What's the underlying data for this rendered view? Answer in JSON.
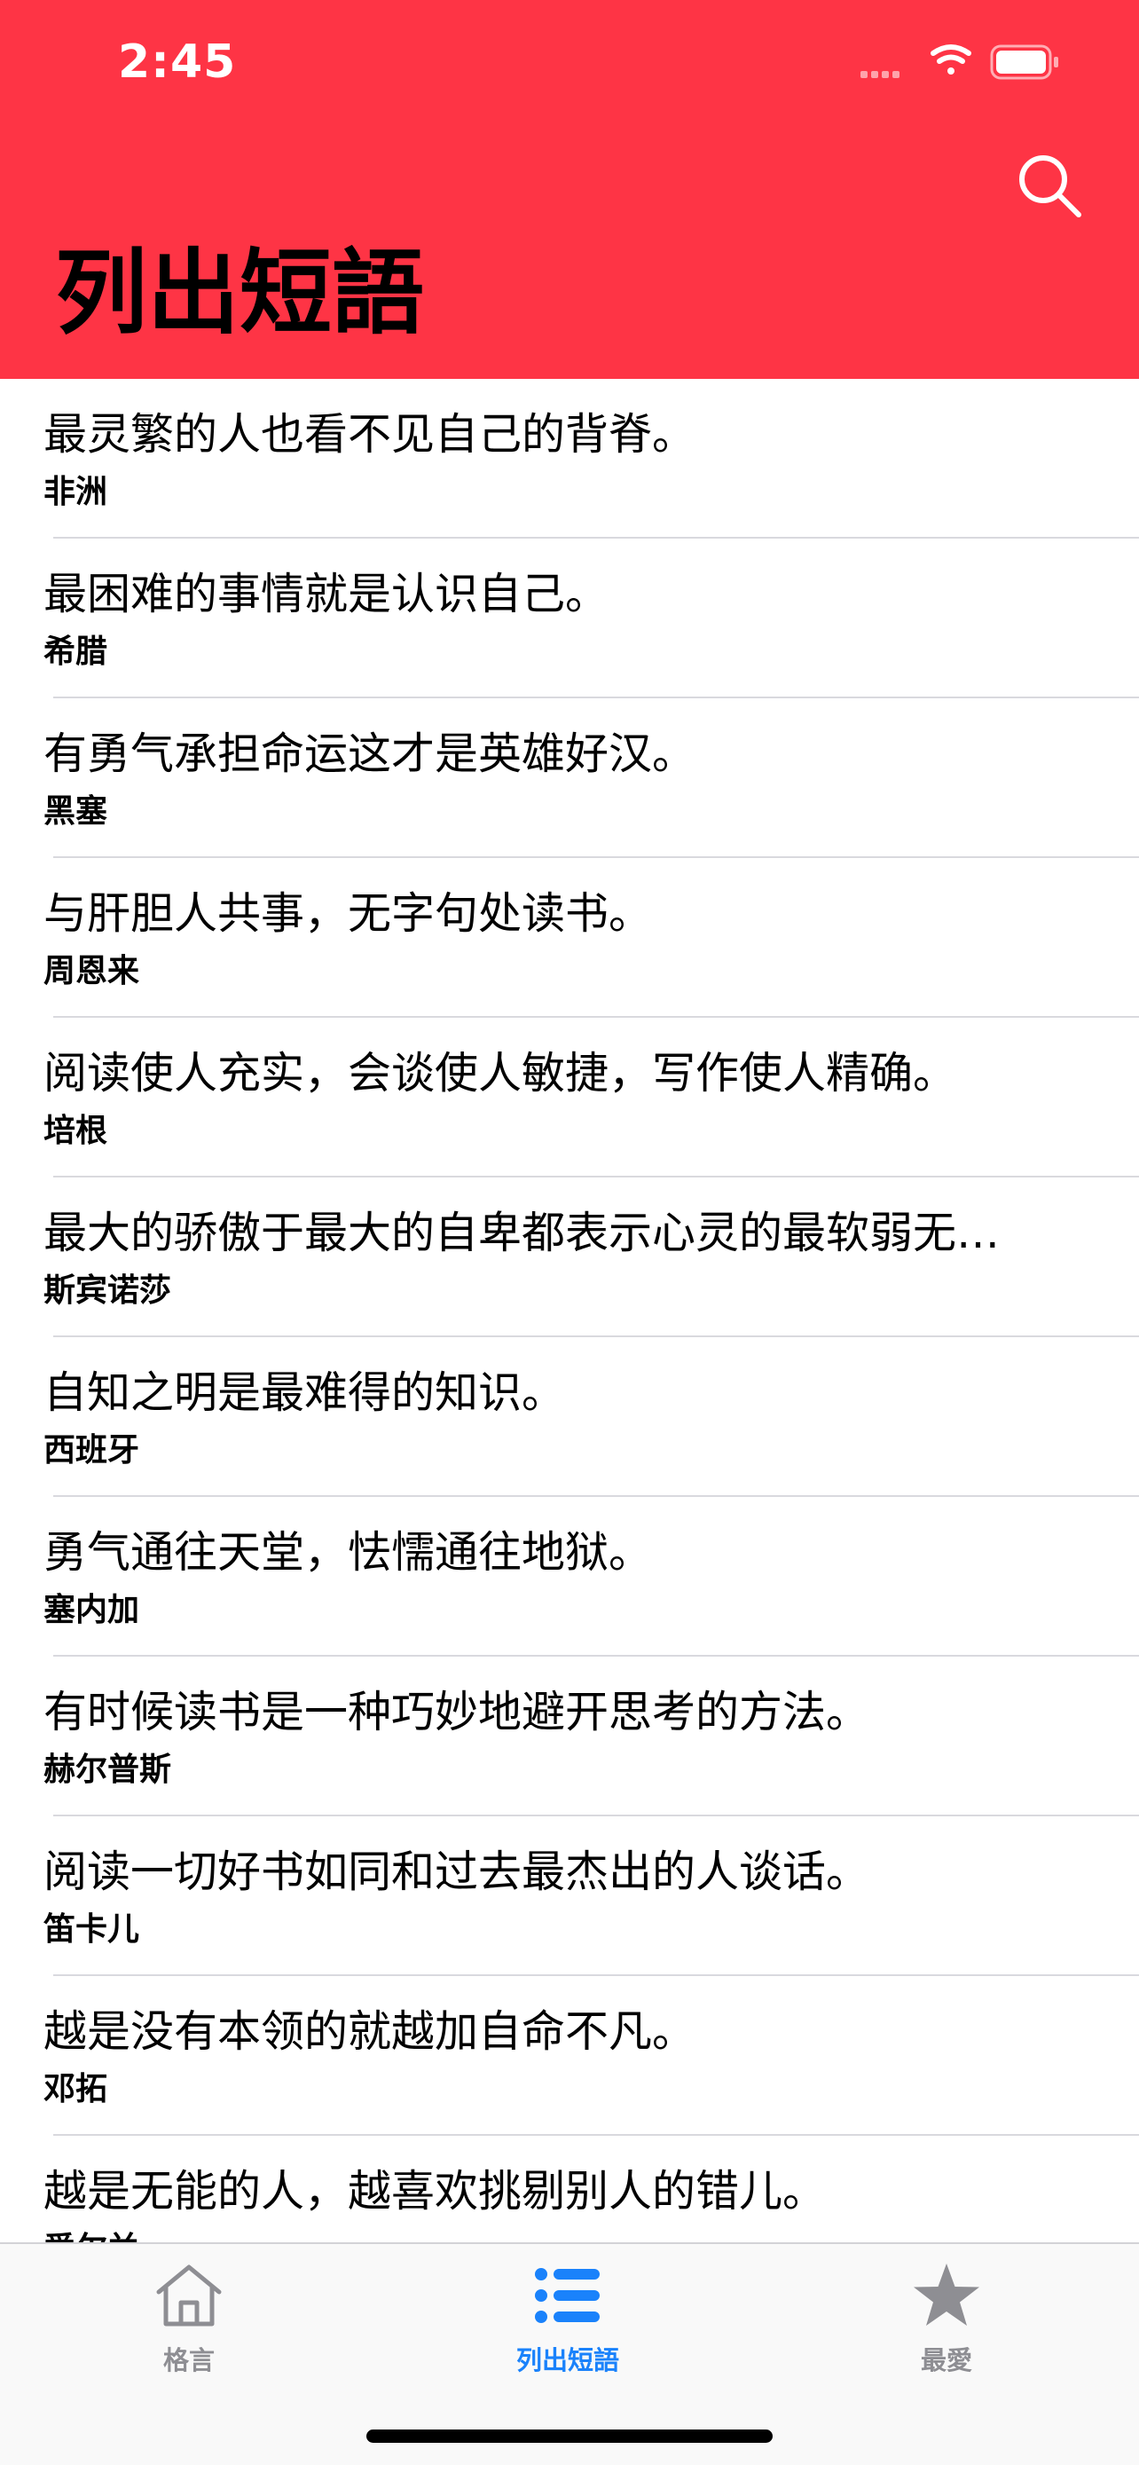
{
  "status_bar": {
    "time": "2:45"
  },
  "header": {
    "title": "列出短語",
    "search_icon": "search-icon",
    "background_color": "#fe3445"
  },
  "list": {
    "items": [
      {
        "quote": "最灵繁的人也看不见自己的背脊。",
        "origin": "非洲"
      },
      {
        "quote": "最困难的事情就是认识自己。",
        "origin": "希腊"
      },
      {
        "quote": "有勇气承担命运这才是英雄好汉。",
        "origin": "黑塞"
      },
      {
        "quote": "与肝胆人共事，无字句处读书。",
        "origin": "周恩来"
      },
      {
        "quote": "阅读使人充实，会谈使人敏捷，写作使人精确。",
        "origin": "培根"
      },
      {
        "quote": "最大的骄傲于最大的自卑都表示心灵的最软弱无…",
        "origin": "斯宾诺莎"
      },
      {
        "quote": "自知之明是最难得的知识。",
        "origin": "西班牙"
      },
      {
        "quote": "勇气通往天堂，怯懦通往地狱。",
        "origin": "塞内加"
      },
      {
        "quote": "有时候读书是一种巧妙地避开思考的方法。",
        "origin": "赫尔普斯"
      },
      {
        "quote": "阅读一切好书如同和过去最杰出的人谈话。",
        "origin": "笛卡儿"
      },
      {
        "quote": "越是没有本领的就越加自命不凡。",
        "origin": "邓拓"
      },
      {
        "quote": "越是无能的人，越喜欢挑剔别人的错儿。",
        "origin": "爱尔兰"
      }
    ]
  },
  "tabbar": {
    "tabs": [
      {
        "label": "格言",
        "icon": "house-icon",
        "active": false
      },
      {
        "label": "列出短語",
        "icon": "list-icon",
        "active": true
      },
      {
        "label": "最愛",
        "icon": "star-icon",
        "active": false
      }
    ],
    "active_color": "#1a82fb",
    "inactive_color": "#8e8e93"
  }
}
